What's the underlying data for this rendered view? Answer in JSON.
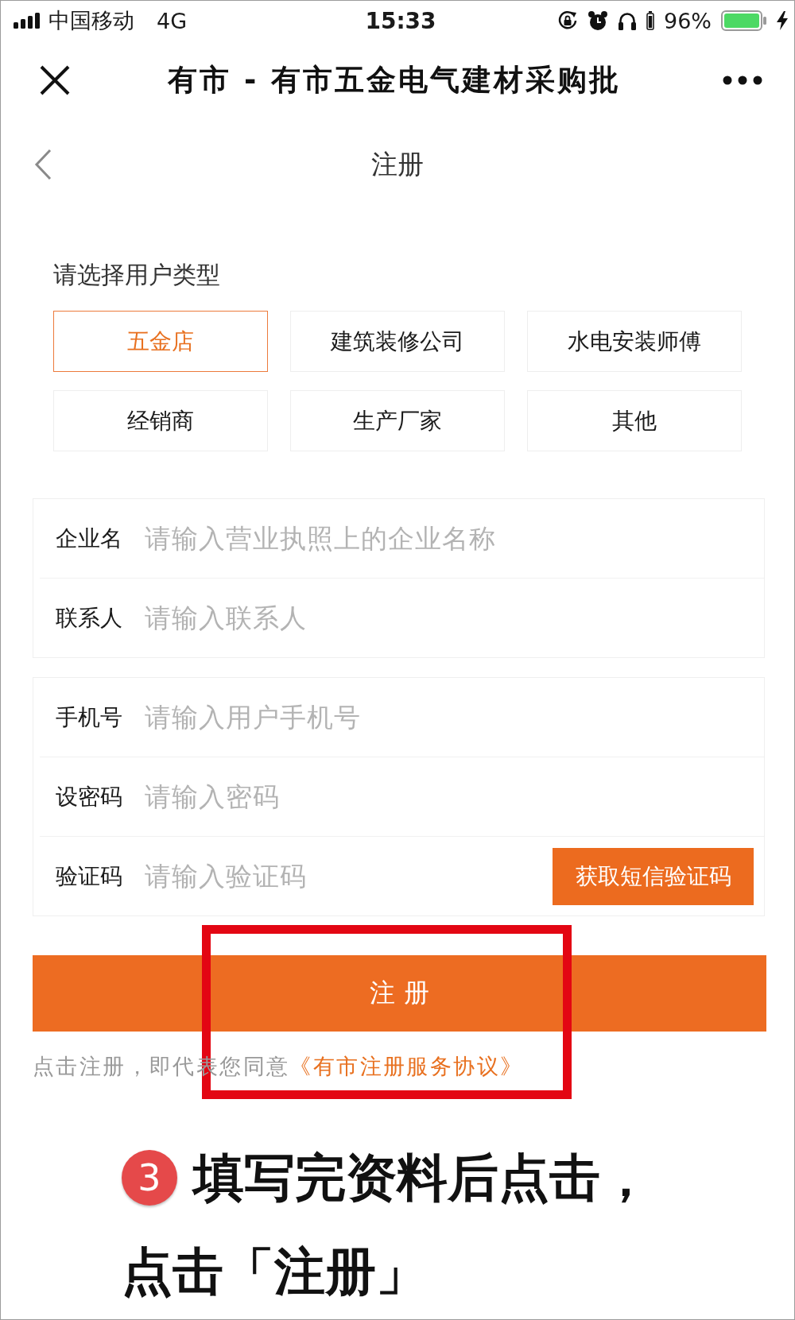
{
  "status_bar": {
    "carrier": "中国移动",
    "network": "4G",
    "time": "15:33",
    "battery": "96%"
  },
  "title_bar": {
    "title": "有市 - 有市五金电气建材采购批"
  },
  "nav_bar": {
    "title": "注册"
  },
  "user_type": {
    "prompt": "请选择用户类型",
    "options": [
      {
        "label": "五金店",
        "selected": true
      },
      {
        "label": "建筑装修公司",
        "selected": false
      },
      {
        "label": "水电安装师傅",
        "selected": false
      },
      {
        "label": "经销商",
        "selected": false
      },
      {
        "label": "生产厂家",
        "selected": false
      },
      {
        "label": "其他",
        "selected": false
      }
    ]
  },
  "form_groups": [
    {
      "fields": [
        {
          "label": "企业名",
          "placeholder": "请输入营业执照上的企业名称"
        },
        {
          "label": "联系人",
          "placeholder": "请输入联系人"
        }
      ]
    },
    {
      "fields": [
        {
          "label": "手机号",
          "placeholder": "请输入用户手机号"
        },
        {
          "label": "设密码",
          "placeholder": "请输入密码"
        },
        {
          "label": "验证码",
          "placeholder": "请输入验证码",
          "action": "获取短信验证码"
        }
      ]
    }
  ],
  "register_button": "注 册",
  "agreement": {
    "text": "点击注册，即代表您同意",
    "link": "《有市注册服务协议》"
  },
  "instruction": {
    "step": "3",
    "lines": [
      "填写完资料后点击，",
      "点击「注册」"
    ]
  }
}
